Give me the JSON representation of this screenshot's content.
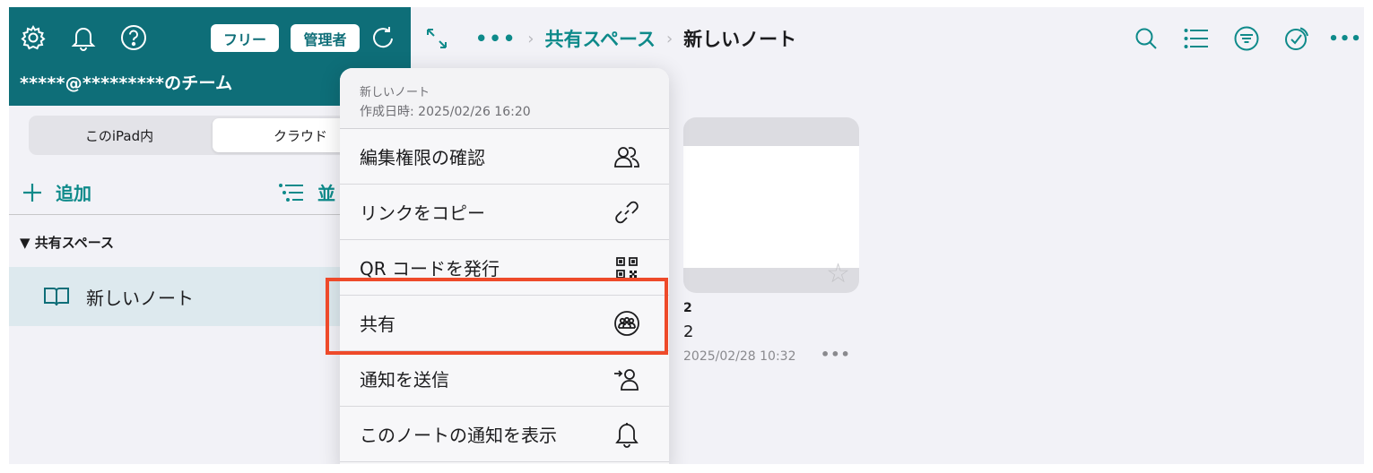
{
  "sidebar": {
    "badges": {
      "free": "フリー",
      "admin": "管理者"
    },
    "team_name": "*****@*********のチーム",
    "segments": [
      {
        "label": "このiPad内"
      },
      {
        "label": "クラウド"
      }
    ],
    "add_label": "追加",
    "sort_label": "並",
    "section_label": "▼ 共有スペース",
    "note_label": "新しいノート"
  },
  "breadcrumb": {
    "more": "•••",
    "parent": "共有スペース",
    "current": "新しいノート",
    "separator": "›"
  },
  "card": {
    "title": "2",
    "subtitle": "2",
    "date": "2025/02/28 10:32",
    "more": "•••",
    "star": "☆"
  },
  "menu": {
    "note_title": "新しいノート",
    "created": "作成日時: 2025/02/26 16:20",
    "items": [
      {
        "label": "編集権限の確認",
        "icon": "people-icon"
      },
      {
        "label": "リンクをコピー",
        "icon": "link-icon"
      },
      {
        "label": "QR コードを発行",
        "icon": "qr-code-icon"
      },
      {
        "label": "共有",
        "icon": "share-group-icon"
      },
      {
        "label": "通知を送信",
        "icon": "send-notification-icon"
      },
      {
        "label": "このノートの通知を表示",
        "icon": "bell-icon"
      }
    ]
  },
  "colors": {
    "header_teal": "#0e6e78",
    "accent_teal": "#0e8a8a",
    "highlight": "#ee4a2a",
    "selected_row": "#dde9ee"
  }
}
